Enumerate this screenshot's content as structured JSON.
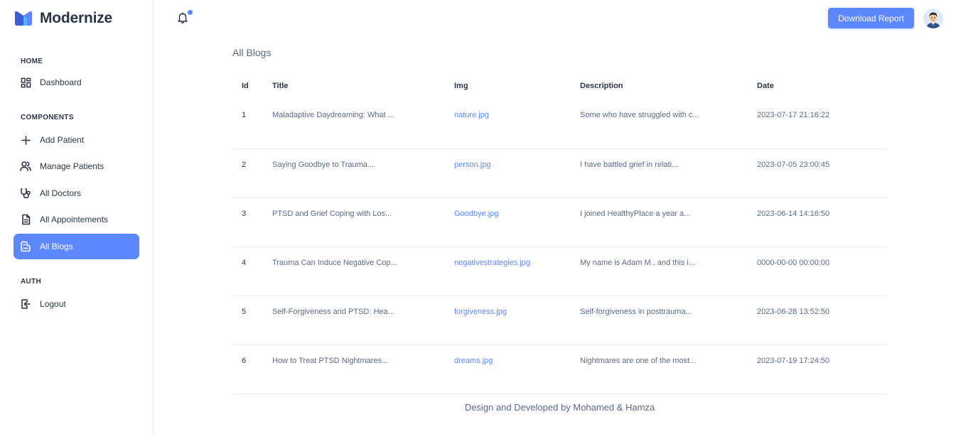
{
  "brand": {
    "name": "Modernize"
  },
  "sidebar": {
    "sections": [
      {
        "title": "HOME"
      },
      {
        "title": "COMPONENTS"
      },
      {
        "title": "AUTH"
      }
    ],
    "items": [
      {
        "label": "Dashboard",
        "icon": "dashboard-icon"
      },
      {
        "label": "Add Patient",
        "icon": "plus-icon"
      },
      {
        "label": "Manage Patients",
        "icon": "users-icon"
      },
      {
        "label": "All Doctors",
        "icon": "stethoscope-icon"
      },
      {
        "label": "All Appointements",
        "icon": "file-text-icon"
      },
      {
        "label": "All Blogs",
        "icon": "blog-icon",
        "active": true
      },
      {
        "label": "Logout",
        "icon": "logout-icon"
      }
    ]
  },
  "header": {
    "notification_icon": "bell-icon",
    "download_label": "Download Report",
    "avatar_icon": "user-avatar"
  },
  "main": {
    "title": "All Blogs",
    "table": {
      "columns": [
        "Id",
        "Title",
        "Img",
        "Description",
        "Date"
      ],
      "rows": [
        [
          "1",
          "Maladaptive Daydreaming: What ...",
          "nature.jpg",
          "Some who have struggled with c...",
          "2023-07-17 21:16:22"
        ],
        [
          "2",
          "Saying Goodbye to Trauma...",
          "person.jpg",
          "I have battled grief in relati...",
          "2023-07-05 23:00:45"
        ],
        [
          "3",
          "PTSD and Grief Coping with Los...",
          "Goodbye.jpg",
          "I joined HealthyPlace a year a...",
          "2023-06-14 14:16:50"
        ],
        [
          "4",
          "Trauma Can Induce Negative Cop...",
          "negativestrategies.jpg",
          "My name is Adam M., and this i...",
          "0000-00-00 00:00:00"
        ],
        [
          "5",
          "Self-Forgiveness and PTSD: Hea...",
          "forgiveness.jpg",
          "Self-forgiveness in posttrauma...",
          "2023-06-28 13:52:50"
        ],
        [
          "6",
          "How to Treat PTSD Nightmares...",
          "dreams.jpg",
          "Nightmares are one of the most...",
          "2023-07-19 17:24:50"
        ]
      ]
    }
  },
  "footer": {
    "text": "Design and Developed by Mohamed & Hamza"
  },
  "colors": {
    "accent": "#5d87ff",
    "text": "#2a3547",
    "muted": "#5a6a85"
  }
}
